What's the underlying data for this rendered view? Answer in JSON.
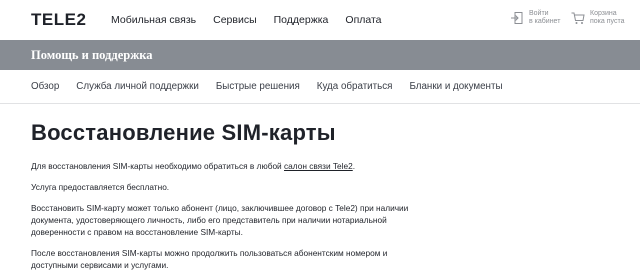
{
  "header": {
    "logo": "TELE2",
    "nav": [
      "Мобильная связь",
      "Сервисы",
      "Поддержка",
      "Оплата"
    ],
    "login": {
      "line1": "Войти",
      "line2": "в кабинет",
      "icon": "login-icon"
    },
    "cart": {
      "line1": "Корзина",
      "line2": "пока пуста",
      "icon": "cart-icon"
    }
  },
  "band": {
    "title": "Помощь и поддержка",
    "color": "#878c93"
  },
  "subnav": [
    "Обзор",
    "Служба личной поддержки",
    "Быстрые решения",
    "Куда обратиться",
    "Бланки и документы"
  ],
  "main": {
    "title": "Восстановление SIM-карты",
    "p1_before": "Для восстановления SIM-карты необходимо обратиться в любой ",
    "p1_link": "салон связи Tele2",
    "p1_after": ".",
    "p2": "Услуга предоставляется бесплатно.",
    "p3": "Восстановить SIM-карту может только абонент (лицо, заключившее договор с Tele2) при наличии документа, удостоверяющего личность, либо его представитель при наличии нотариальной доверенности с правом на восстановление SIM-карты.",
    "p4": "После восстановления SIM-карты можно продолжить пользоваться абонентским номером и доступными сервисами и услугами."
  }
}
